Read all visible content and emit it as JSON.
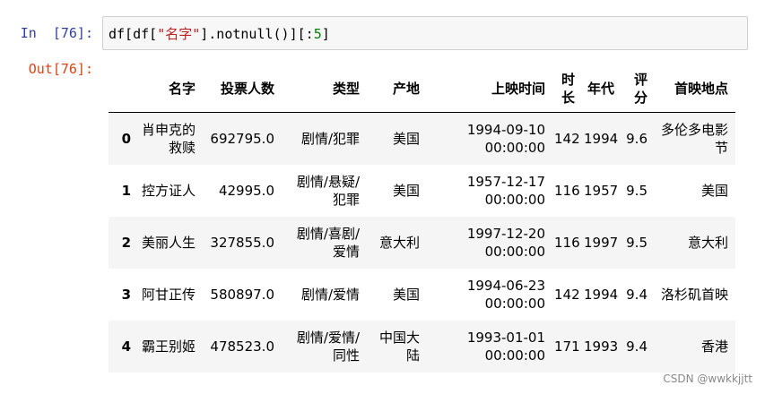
{
  "cell": {
    "in_prompt": "In  [76]:",
    "out_prompt": "Out[76]:",
    "code": {
      "part1": "df[df[",
      "string": "\"名字\"",
      "part2": "].notnull()][:",
      "number": "5",
      "part3": "]"
    }
  },
  "table": {
    "columns": [
      "名字",
      "投票人数",
      "类型",
      "产地",
      "上映时间",
      "时长",
      "年代",
      "评分",
      "首映地点"
    ],
    "rows": [
      {
        "index": "0",
        "cells": [
          "肖申克的救赎",
          "692795.0",
          "剧情/犯罪",
          "美国",
          "1994-09-10 00:00:00",
          "142",
          "1994",
          "9.6",
          "多伦多电影节"
        ]
      },
      {
        "index": "1",
        "cells": [
          "控方证人",
          "42995.0",
          "剧情/悬疑/犯罪",
          "美国",
          "1957-12-17 00:00:00",
          "116",
          "1957",
          "9.5",
          "美国"
        ]
      },
      {
        "index": "2",
        "cells": [
          "美丽人生",
          "327855.0",
          "剧情/喜剧/爱情",
          "意大利",
          "1997-12-20 00:00:00",
          "116",
          "1997",
          "9.5",
          "意大利"
        ]
      },
      {
        "index": "3",
        "cells": [
          "阿甘正传",
          "580897.0",
          "剧情/爱情",
          "美国",
          "1994-06-23 00:00:00",
          "142",
          "1994",
          "9.4",
          "洛杉矶首映"
        ]
      },
      {
        "index": "4",
        "cells": [
          "霸王别姬",
          "478523.0",
          "剧情/爱情/同性",
          "中国大陆",
          "1993-01-01 00:00:00",
          "171",
          "1993",
          "9.4",
          "香港"
        ]
      }
    ]
  },
  "watermark": "CSDN @wwkkjjtt"
}
